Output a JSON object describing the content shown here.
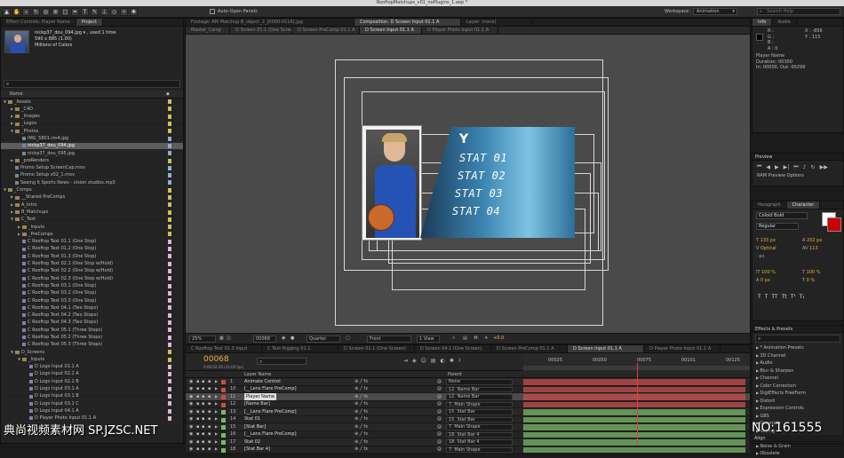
{
  "window": {
    "title": "RooftopMatchups_v01_noPlugins_1.aep *"
  },
  "toolbar": {
    "auto_open": "Auto-Open Panels",
    "workspace_label": "Workspace:",
    "workspace": "Animation",
    "search_placeholder": "Search Help"
  },
  "project": {
    "tabs": [
      "Effect Controls: Player Name",
      "Project"
    ],
    "selected_file": "nickp37_dou_094.jpg ▾ , used 1 time",
    "dimensions": "590 x 885 (1.00)",
    "colors": "Millions of Colors",
    "name_header": "Name",
    "items": [
      {
        "label": "_Assets",
        "level": 0,
        "kind": "folder",
        "open": true,
        "color": "#c9c25a"
      },
      {
        "label": "_C4D",
        "level": 1,
        "kind": "folder",
        "open": false,
        "color": "#c9c25a"
      },
      {
        "label": "_Images",
        "level": 1,
        "kind": "folder",
        "open": false,
        "color": "#c9c25a"
      },
      {
        "label": "_Logos",
        "level": 1,
        "kind": "folder",
        "open": false,
        "color": "#c9c25a"
      },
      {
        "label": "_Photos",
        "level": 1,
        "kind": "folder",
        "open": true,
        "color": "#c9c25a"
      },
      {
        "label": "IMG_5801-rm4.jpg",
        "level": 2,
        "kind": "file",
        "color": "#9aa8c8"
      },
      {
        "label": "nickp37_dou_094.jpg",
        "level": 2,
        "kind": "file",
        "color": "#9aa8c8",
        "selected": true
      },
      {
        "label": "nickp37_dou_095.jpg",
        "level": 2,
        "kind": "file",
        "color": "#9aa8c8"
      },
      {
        "label": "_preRenders",
        "level": 1,
        "kind": "folder",
        "open": false,
        "color": "#c9c25a"
      },
      {
        "label": "Promo Setup ScreenCap.mov",
        "level": 1,
        "kind": "file",
        "color": "#8fb3c8"
      },
      {
        "label": "Promo Setup v02_1.mov",
        "level": 1,
        "kind": "file",
        "color": "#8fb3c8"
      },
      {
        "label": "Seeing It Sports News - vision studios.mp3",
        "level": 1,
        "kind": "file",
        "color": "#8fb3c8"
      },
      {
        "label": "_Comps",
        "level": 0,
        "kind": "folder",
        "open": true,
        "color": "#c9c25a"
      },
      {
        "label": "__Shared PreComps",
        "level": 1,
        "kind": "folder",
        "open": false,
        "color": "#c9c25a"
      },
      {
        "label": "A_Intro",
        "level": 1,
        "kind": "folder",
        "open": false,
        "color": "#c9c25a"
      },
      {
        "label": "B_Matchups",
        "level": 1,
        "kind": "folder",
        "open": false,
        "color": "#c9c25a"
      },
      {
        "label": "C_Text",
        "level": 1,
        "kind": "folder",
        "open": true,
        "color": "#c9c25a"
      },
      {
        "label": "_Inputs",
        "level": 2,
        "kind": "folder",
        "open": false,
        "color": "#c9c25a"
      },
      {
        "label": "_PreComps",
        "level": 2,
        "kind": "folder",
        "open": false,
        "color": "#c9c25a"
      },
      {
        "label": "C Rooftop Text 01.1 (One Stop)",
        "level": 2,
        "kind": "comp",
        "color": "#d9b8d4"
      },
      {
        "label": "C Rooftop Text 01.2 (One Stop)",
        "level": 2,
        "kind": "comp",
        "color": "#d9b8d4"
      },
      {
        "label": "C Rooftop Text 01.3 (One Stop)",
        "level": 2,
        "kind": "comp",
        "color": "#d9b8d4"
      },
      {
        "label": "C Rooftop Text 02.1 (One Stop w/Hold)",
        "level": 2,
        "kind": "comp",
        "color": "#d9b8d4"
      },
      {
        "label": "C Rooftop Text 02.2 (One Stop w/Hold)",
        "level": 2,
        "kind": "comp",
        "color": "#d9b8d4"
      },
      {
        "label": "C Rooftop Text 02.3 (One Stop w/Hold)",
        "level": 2,
        "kind": "comp",
        "color": "#d9b8d4"
      },
      {
        "label": "C Rooftop Text 03.1 (One Stop)",
        "level": 2,
        "kind": "comp",
        "color": "#d9b8d4"
      },
      {
        "label": "C Rooftop Text 03.2 (One Stop)",
        "level": 2,
        "kind": "comp",
        "color": "#d9b8d4"
      },
      {
        "label": "C Rooftop Text 03.3 (One Stop)",
        "level": 2,
        "kind": "comp",
        "color": "#d9b8d4"
      },
      {
        "label": "C Rooftop Text 04.1 (Two Stops)",
        "level": 2,
        "kind": "comp",
        "color": "#d9b8d4"
      },
      {
        "label": "C Rooftop Text 04.2 (Two Stops)",
        "level": 2,
        "kind": "comp",
        "color": "#d9b8d4"
      },
      {
        "label": "C Rooftop Text 04.3 (Two Stops)",
        "level": 2,
        "kind": "comp",
        "color": "#d9b8d4"
      },
      {
        "label": "C Rooftop Text 05.1 (Three Stops)",
        "level": 2,
        "kind": "comp",
        "color": "#d9b8d4"
      },
      {
        "label": "C Rooftop Text 05.2 (Three Stops)",
        "level": 2,
        "kind": "comp",
        "color": "#d9b8d4"
      },
      {
        "label": "C Rooftop Text 05.3 (Three Stops)",
        "level": 2,
        "kind": "comp",
        "color": "#d9b8d4"
      },
      {
        "label": "D_Screens",
        "level": 1,
        "kind": "folder",
        "open": true,
        "color": "#c9c25a"
      },
      {
        "label": "_Inputs",
        "level": 2,
        "kind": "folder",
        "open": true,
        "color": "#c9c25a"
      },
      {
        "label": "D Logo Input 01.1 A",
        "level": 3,
        "kind": "comp",
        "color": "#d9b8d4"
      },
      {
        "label": "D Logo Input 02.1 A",
        "level": 3,
        "kind": "comp",
        "color": "#d9b8d4"
      },
      {
        "label": "D Logo Input 02.1 B",
        "level": 3,
        "kind": "comp",
        "color": "#d9b8d4"
      },
      {
        "label": "D Logo Input 03.1 A",
        "level": 3,
        "kind": "comp",
        "color": "#d9b8d4"
      },
      {
        "label": "D Logo Input 03.1 B",
        "level": 3,
        "kind": "comp",
        "color": "#d9b8d4"
      },
      {
        "label": "D Logo Input 03.1 C",
        "level": 3,
        "kind": "comp",
        "color": "#d9b8d4"
      },
      {
        "label": "D Logo Input 04.1 A",
        "level": 3,
        "kind": "comp",
        "color": "#d9b8d4"
      },
      {
        "label": "D Player Photo Input 01.1 A",
        "level": 3,
        "kind": "comp",
        "color": "#d9b8d4"
      }
    ]
  },
  "viewer": {
    "tabs": [
      "Footage: RM Matchup B_object_2_[0000-0116].jpg",
      "Composition: D Screen Input 01.1 A",
      "Layer: (none)"
    ],
    "subtabs": [
      "Master_Comp",
      "D Screen 01.1 (One Screen)",
      "D Screen PreComp 01.1 A",
      "D Screen Input 01.1 A",
      "D Player Photo Input 01.1 A"
    ],
    "header_letter": "Y",
    "stats": [
      "STAT 01",
      "STAT 02",
      "STAT 03",
      "STAT 04"
    ],
    "zoom": "25%",
    "timecode": "00068",
    "resolution": "Quarter",
    "view_mode": "Front",
    "views": "1 View",
    "exposure": "+0.0"
  },
  "timeline": {
    "tabs": [
      "C Rooftop Text 01.3 Input",
      "C Text Rigging 01.1",
      "D Screen 01.1 (One Screen)",
      "D Screen 04.1 (One Screen)",
      "D Screen PreComp 01.1 A",
      "D Screen Input 01.1 A",
      "D Player Photo Input 01.1 A"
    ],
    "current_time": "00068",
    "time_sub": "0:00:02:20 (24.00 fps)",
    "col_layer": "Layer Name",
    "col_parent": "Parent",
    "ruler": [
      "00025",
      "00050",
      "00075",
      "00101",
      "00125"
    ],
    "current_fraction": 0.5,
    "layers": [
      {
        "num": "1",
        "name": "Animate Control",
        "parent": "None",
        "color": "#c94c4c"
      },
      {
        "num": "10",
        "name": "[__Lens Flare PreComp]",
        "parent": "12. Name Bar",
        "color": "#c94c4c"
      },
      {
        "num": "11",
        "name": "Player Name",
        "parent": "12. Name Bar",
        "color": "#c94c4c",
        "selected": true
      },
      {
        "num": "12",
        "name": "[Name Bar]",
        "parent": "7. Main Shape",
        "color": "#c94c4c"
      },
      {
        "num": "13",
        "name": "[__Lens Flare PreComp]",
        "parent": "15. Stat Bar",
        "color": "#7ab86a"
      },
      {
        "num": "14",
        "name": "Stat 01",
        "parent": "15. Stat Bar",
        "color": "#7ab86a"
      },
      {
        "num": "15",
        "name": "[Stat Bar]",
        "parent": "7. Main Shape",
        "color": "#7ab86a"
      },
      {
        "num": "16",
        "name": "[__Lens Flare PreComp]",
        "parent": "18. Stat Bar 4",
        "color": "#7ab86a"
      },
      {
        "num": "17",
        "name": "Stat 02",
        "parent": "18. Stat Bar 4",
        "color": "#7ab86a"
      },
      {
        "num": "18",
        "name": "[Stat Bar 4]",
        "parent": "7. Main Shape",
        "color": "#7ab86a"
      }
    ]
  },
  "right": {
    "info_tabs": [
      "Info",
      "Audio"
    ],
    "rgb": [
      "R :",
      "G :",
      "B :",
      "A : 0"
    ],
    "xy": [
      "X : -856",
      "Y : 115"
    ],
    "layer_info": [
      "Player Name",
      "Duration: 00300",
      "In: 00000, Out: 00299"
    ],
    "preview_tab": "Preview",
    "ram_preview": "RAM Preview Options",
    "char_tabs": [
      "Paragraph",
      "Character"
    ],
    "font": "Coloid Bold",
    "style": "Regular",
    "font_size": "133 px",
    "leading": "202 px",
    "kerning": "Optical",
    "tracking": "113",
    "px_field": "- px",
    "v_scale": "100 %",
    "h_scale": "100 %",
    "baseline": "0 px",
    "tsume": "0 %",
    "effects_tab": "Effects & Presets",
    "effects": [
      "* Animation Presets",
      "3D Channel",
      "Audio",
      "Blur & Sharpen",
      "Channel",
      "Color Correction",
      "DigiEffects FreeForm",
      "Distort",
      "Expression Controls",
      "GBS",
      "Generate",
      "Keying",
      "Matte",
      "Noise & Grain",
      "Obsolete"
    ],
    "align_tab": "Align"
  },
  "watermark": {
    "left": "典尚视频素材网 SP.JZSC.NET",
    "right": "NO:161555"
  }
}
